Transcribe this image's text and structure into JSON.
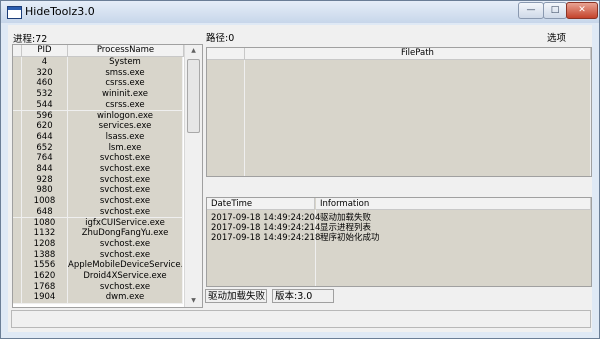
{
  "window": {
    "title": "HideToolz3.0"
  },
  "left": {
    "process_label": "进程:72",
    "columns": [
      "PID",
      "ProcessName"
    ],
    "rows": [
      {
        "pid": "4",
        "name": "System"
      },
      {
        "pid": "320",
        "name": "smss.exe"
      },
      {
        "pid": "460",
        "name": "csrss.exe"
      },
      {
        "pid": "532",
        "name": "wininit.exe"
      },
      {
        "pid": "544",
        "name": "csrss.exe"
      },
      {
        "pid": "596",
        "name": "winlogon.exe"
      },
      {
        "pid": "620",
        "name": "services.exe"
      },
      {
        "pid": "644",
        "name": "lsass.exe"
      },
      {
        "pid": "652",
        "name": "lsm.exe"
      },
      {
        "pid": "764",
        "name": "svchost.exe"
      },
      {
        "pid": "844",
        "name": "svchost.exe"
      },
      {
        "pid": "928",
        "name": "svchost.exe"
      },
      {
        "pid": "980",
        "name": "svchost.exe"
      },
      {
        "pid": "1008",
        "name": "svchost.exe"
      },
      {
        "pid": "648",
        "name": "svchost.exe"
      },
      {
        "pid": "1080",
        "name": "igfxCUIService.exe"
      },
      {
        "pid": "1132",
        "name": "ZhuDongFangYu.exe"
      },
      {
        "pid": "1208",
        "name": "svchost.exe"
      },
      {
        "pid": "1388",
        "name": "svchost.exe"
      },
      {
        "pid": "1556",
        "name": "AppleMobileDeviceService..."
      },
      {
        "pid": "1620",
        "name": "Droid4XService.exe"
      },
      {
        "pid": "1768",
        "name": "svchost.exe"
      },
      {
        "pid": "1904",
        "name": "dwm.exe"
      }
    ]
  },
  "right": {
    "path_label": "路径:0",
    "options_label": "选项",
    "path_columns": [
      "FilePath"
    ],
    "log_columns": [
      "DateTime",
      "Information"
    ],
    "log_rows": [
      {
        "dt": "2017-09-18 14:49:24:204",
        "info": "驱动加载失败"
      },
      {
        "dt": "2017-09-18 14:49:24:214",
        "info": "显示进程列表"
      },
      {
        "dt": "2017-09-18 14:49:24:218",
        "info": "程序初始化成功"
      }
    ]
  },
  "status": {
    "driver": "驱动加载失败",
    "version": "版本:3.0"
  },
  "controls": {
    "minimize": "—",
    "maximize": "□",
    "close": "✕"
  }
}
